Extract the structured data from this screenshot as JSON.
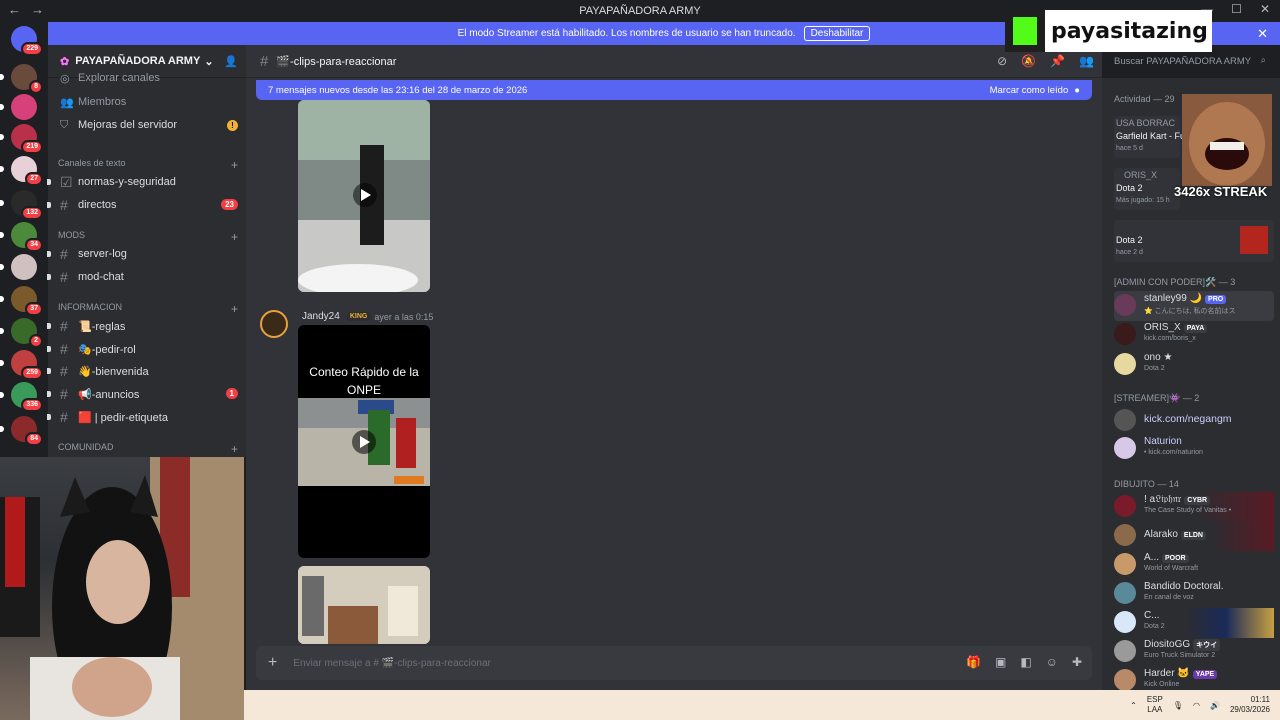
{
  "window": {
    "title": "PAYAPAÑADORA ARMY",
    "back": "←",
    "forward": "→",
    "minimize": "—",
    "maximize": "☐",
    "close": "✕"
  },
  "streamer_mode": {
    "text": "El modo Streamer está habilitado. Los nombres de usuario se han truncado.",
    "button": "Deshabilitar"
  },
  "rail": {
    "badges": [
      "229",
      "8",
      "219",
      "27",
      "132",
      "34",
      "37",
      "2",
      "259",
      "336",
      "84"
    ]
  },
  "sidebar": {
    "server_name": "PAYAPAÑADORA ARMY",
    "top_items": [
      {
        "label": "Explorar canales"
      },
      {
        "label": "Miembros"
      },
      {
        "label": "Mejoras del servidor"
      }
    ],
    "categories": {
      "texto": "Canales de texto",
      "mods": "MODS",
      "info": "INFORMACION",
      "comunidad": "COMUNIDAD"
    },
    "channels": [
      {
        "label": "normas-y-seguridad",
        "count": ""
      },
      {
        "label": "directos",
        "count": "23"
      },
      {
        "label": "server-log",
        "count": ""
      },
      {
        "label": "mod-chat",
        "count": ""
      },
      {
        "label": "📜-reglas",
        "count": ""
      },
      {
        "label": "🎭-pedir-rol",
        "count": ""
      },
      {
        "label": "👋-bienvenida",
        "count": ""
      },
      {
        "label": "📢-anuncios",
        "count": "1"
      },
      {
        "label": "🟥 | pedir-etiqueta",
        "count": ""
      }
    ]
  },
  "chat": {
    "channel_name": "🎬-clips-para-reaccionar",
    "new_messages": "7 mensajes nuevos desde las 23:16 del 28 de marzo de 2026",
    "mark_read": "Marcar como leído",
    "message": {
      "author": "Jandy24",
      "role_badge": "KING",
      "time": "ayer a las 0:15",
      "video_caption": "Conteo Rápido de la ONPE"
    },
    "composer_placeholder": "Enviar mensaje a # 🎬-clips-para-reaccionar",
    "search_placeholder": "Buscar PAYAPAÑADORA ARMY"
  },
  "members": {
    "activity_header": "Actividad — 29",
    "activities": [
      {
        "name": "USA BORRAC",
        "game": "Garfield Kart - Fu",
        "time": "hace 5 d"
      },
      {
        "name": "ORIS_X",
        "game": "Dota 2",
        "time": "Más jugado: 15 h"
      },
      {
        "name": "",
        "game": "Dota 2",
        "time": "hace 2 d"
      }
    ],
    "groups": [
      {
        "title": "[ADMIN CON PODER]🛠️ — 3",
        "members": [
          {
            "name": "stanley99 🌙",
            "tag": "PRO",
            "sub": "⭐ こんにちは, 私の名前はス"
          },
          {
            "name": "ORIS_X",
            "tag": "PAYA",
            "sub": "kick.com/boris_x"
          },
          {
            "name": "ono ★",
            "tag": "",
            "sub": "Dota 2"
          }
        ]
      },
      {
        "title": "[STREAMER]👾 — 2",
        "members": [
          {
            "name": "kick.com/negangm",
            "tag": "",
            "sub": ""
          },
          {
            "name": "Naturion",
            "tag": "",
            "sub": "• kick.com/naturion"
          }
        ]
      },
      {
        "title": "DIBUJITO — 14",
        "members": [
          {
            "name": "! a𝔏𝔦𝔭𝔥𝔫𝔯",
            "tag": "CYBR",
            "sub": "The Case Study of Vanitas •"
          },
          {
            "name": "Alarako",
            "tag": "ELDN",
            "sub": ""
          },
          {
            "name": "A...",
            "tag": "POOR",
            "sub": "World of Warcraft"
          },
          {
            "name": "Bandido Doctoral.",
            "tag": "",
            "sub": "En canal de voz"
          },
          {
            "name": "C...",
            "tag": "",
            "sub": "Dota 2"
          },
          {
            "name": "DiositoGG",
            "tag": "キウイ",
            "sub": "Euro Truck Simulator 2"
          },
          {
            "name": "Harder 🐱",
            "tag": "YAPE",
            "sub": "Kick Online"
          }
        ]
      }
    ]
  },
  "overlay": {
    "logo_text": "payasitazing",
    "streak": "3426x STREAK"
  },
  "taskbar": {
    "lang_top": "ESP",
    "lang_bottom": "LAA",
    "time": "01:11",
    "date": "29/03/2026"
  }
}
